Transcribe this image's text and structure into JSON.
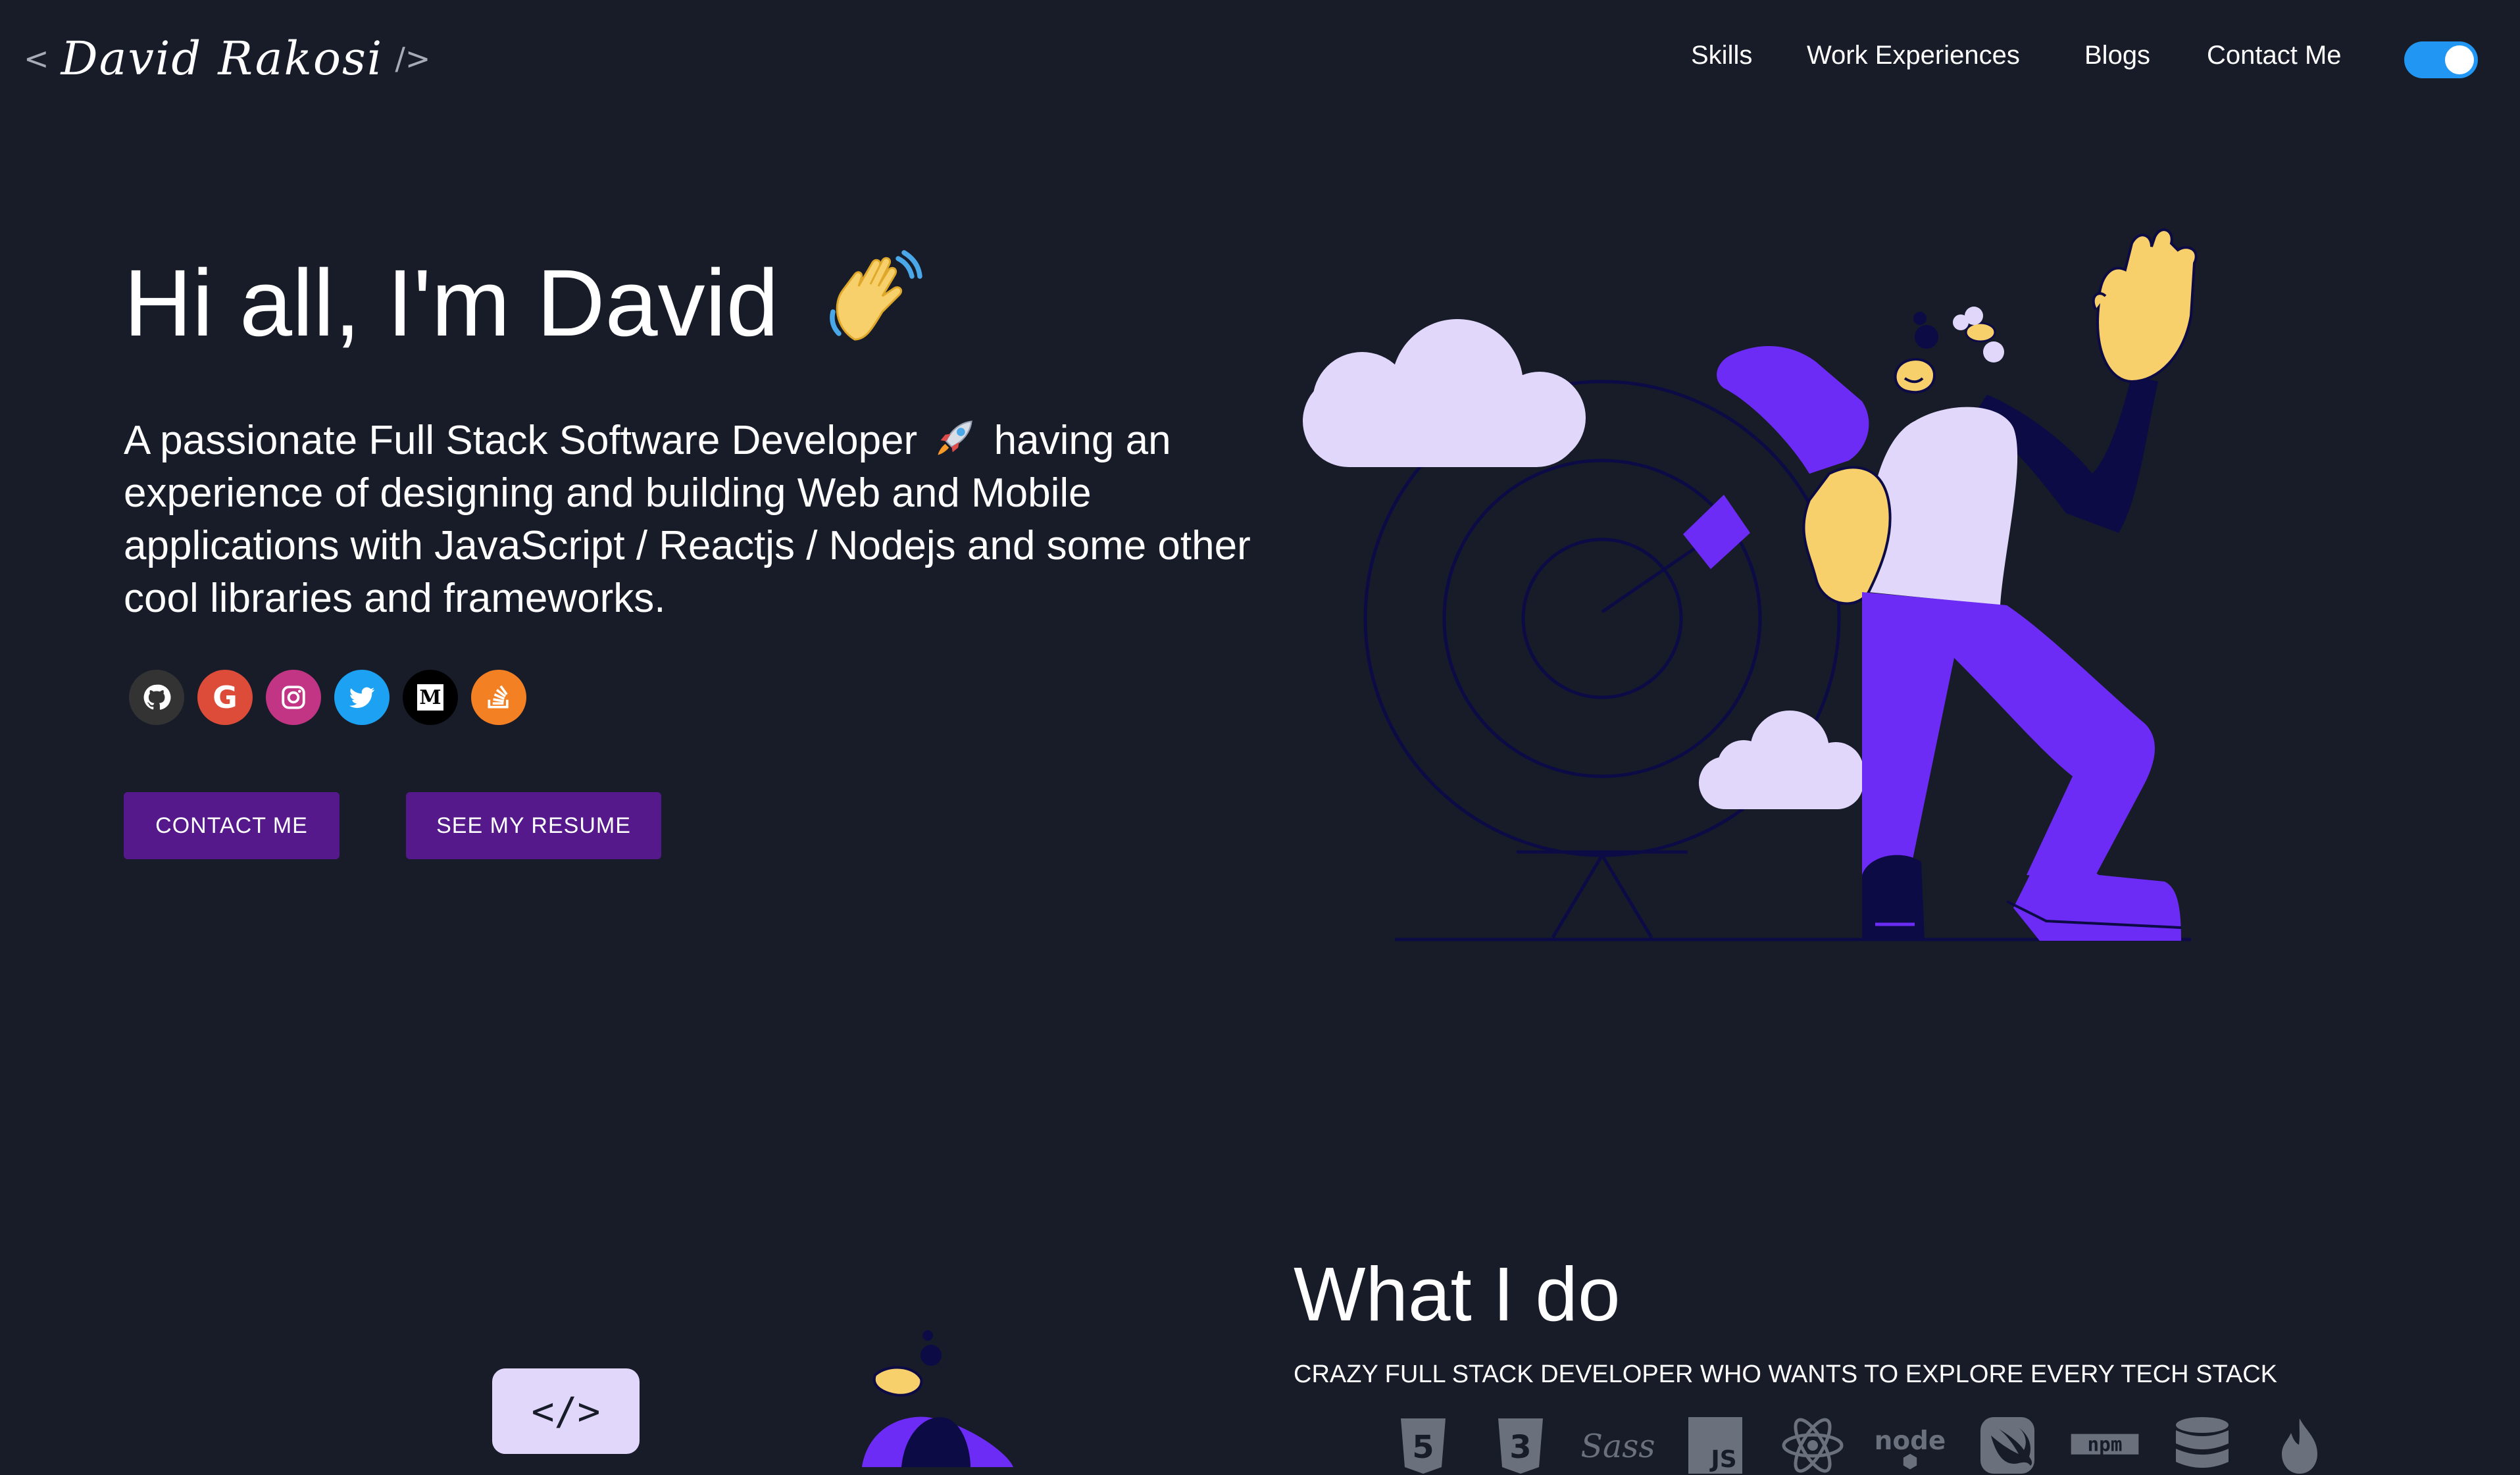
{
  "header": {
    "logo": {
      "left_bracket": "<",
      "signature": "David Rakosi",
      "right_bracket": "/>"
    },
    "nav": [
      {
        "label": "Skills"
      },
      {
        "label": "Work Experiences"
      },
      {
        "label": "Blogs"
      },
      {
        "label": "Contact Me"
      }
    ],
    "theme_toggle": {
      "checked": true
    }
  },
  "hero": {
    "title": "Hi all, I'm David",
    "title_emoji": "waving-hand",
    "subtitle_part1": "A passionate Full Stack Software Developer",
    "subtitle_emoji": "rocket",
    "subtitle_part2": "having an experience of designing and building Web and Mobile applications with JavaScript / Reactjs / Nodejs and some other cool libraries and frameworks.",
    "socials": [
      {
        "name": "github",
        "color": "#333333"
      },
      {
        "name": "google",
        "color": "#dd4b39"
      },
      {
        "name": "instagram",
        "color": "#c13584"
      },
      {
        "name": "twitter",
        "color": "#1da1f2"
      },
      {
        "name": "medium",
        "color": "#000000"
      },
      {
        "name": "stack-overflow",
        "color": "#f48024"
      }
    ],
    "buttons": {
      "contact": "CONTACT ME",
      "resume": "SEE MY RESUME"
    }
  },
  "what_i_do": {
    "title": "What I do",
    "subtitle": "CRAZY FULL STACK DEVELOPER WHO WANTS TO EXPLORE EVERY TECH STACK",
    "code_bubble": "</>",
    "skills": [
      "html5",
      "css3",
      "sass",
      "javascript",
      "reactjs",
      "nodejs",
      "swift",
      "npm",
      "sql-database",
      "firebase"
    ]
  },
  "colors": {
    "background": "#171c28",
    "button": "#55198b",
    "toggle": "#2196f3",
    "purple": "#6c2cf5",
    "lavender": "#e1d7fb",
    "skin": "#f7d06b"
  }
}
